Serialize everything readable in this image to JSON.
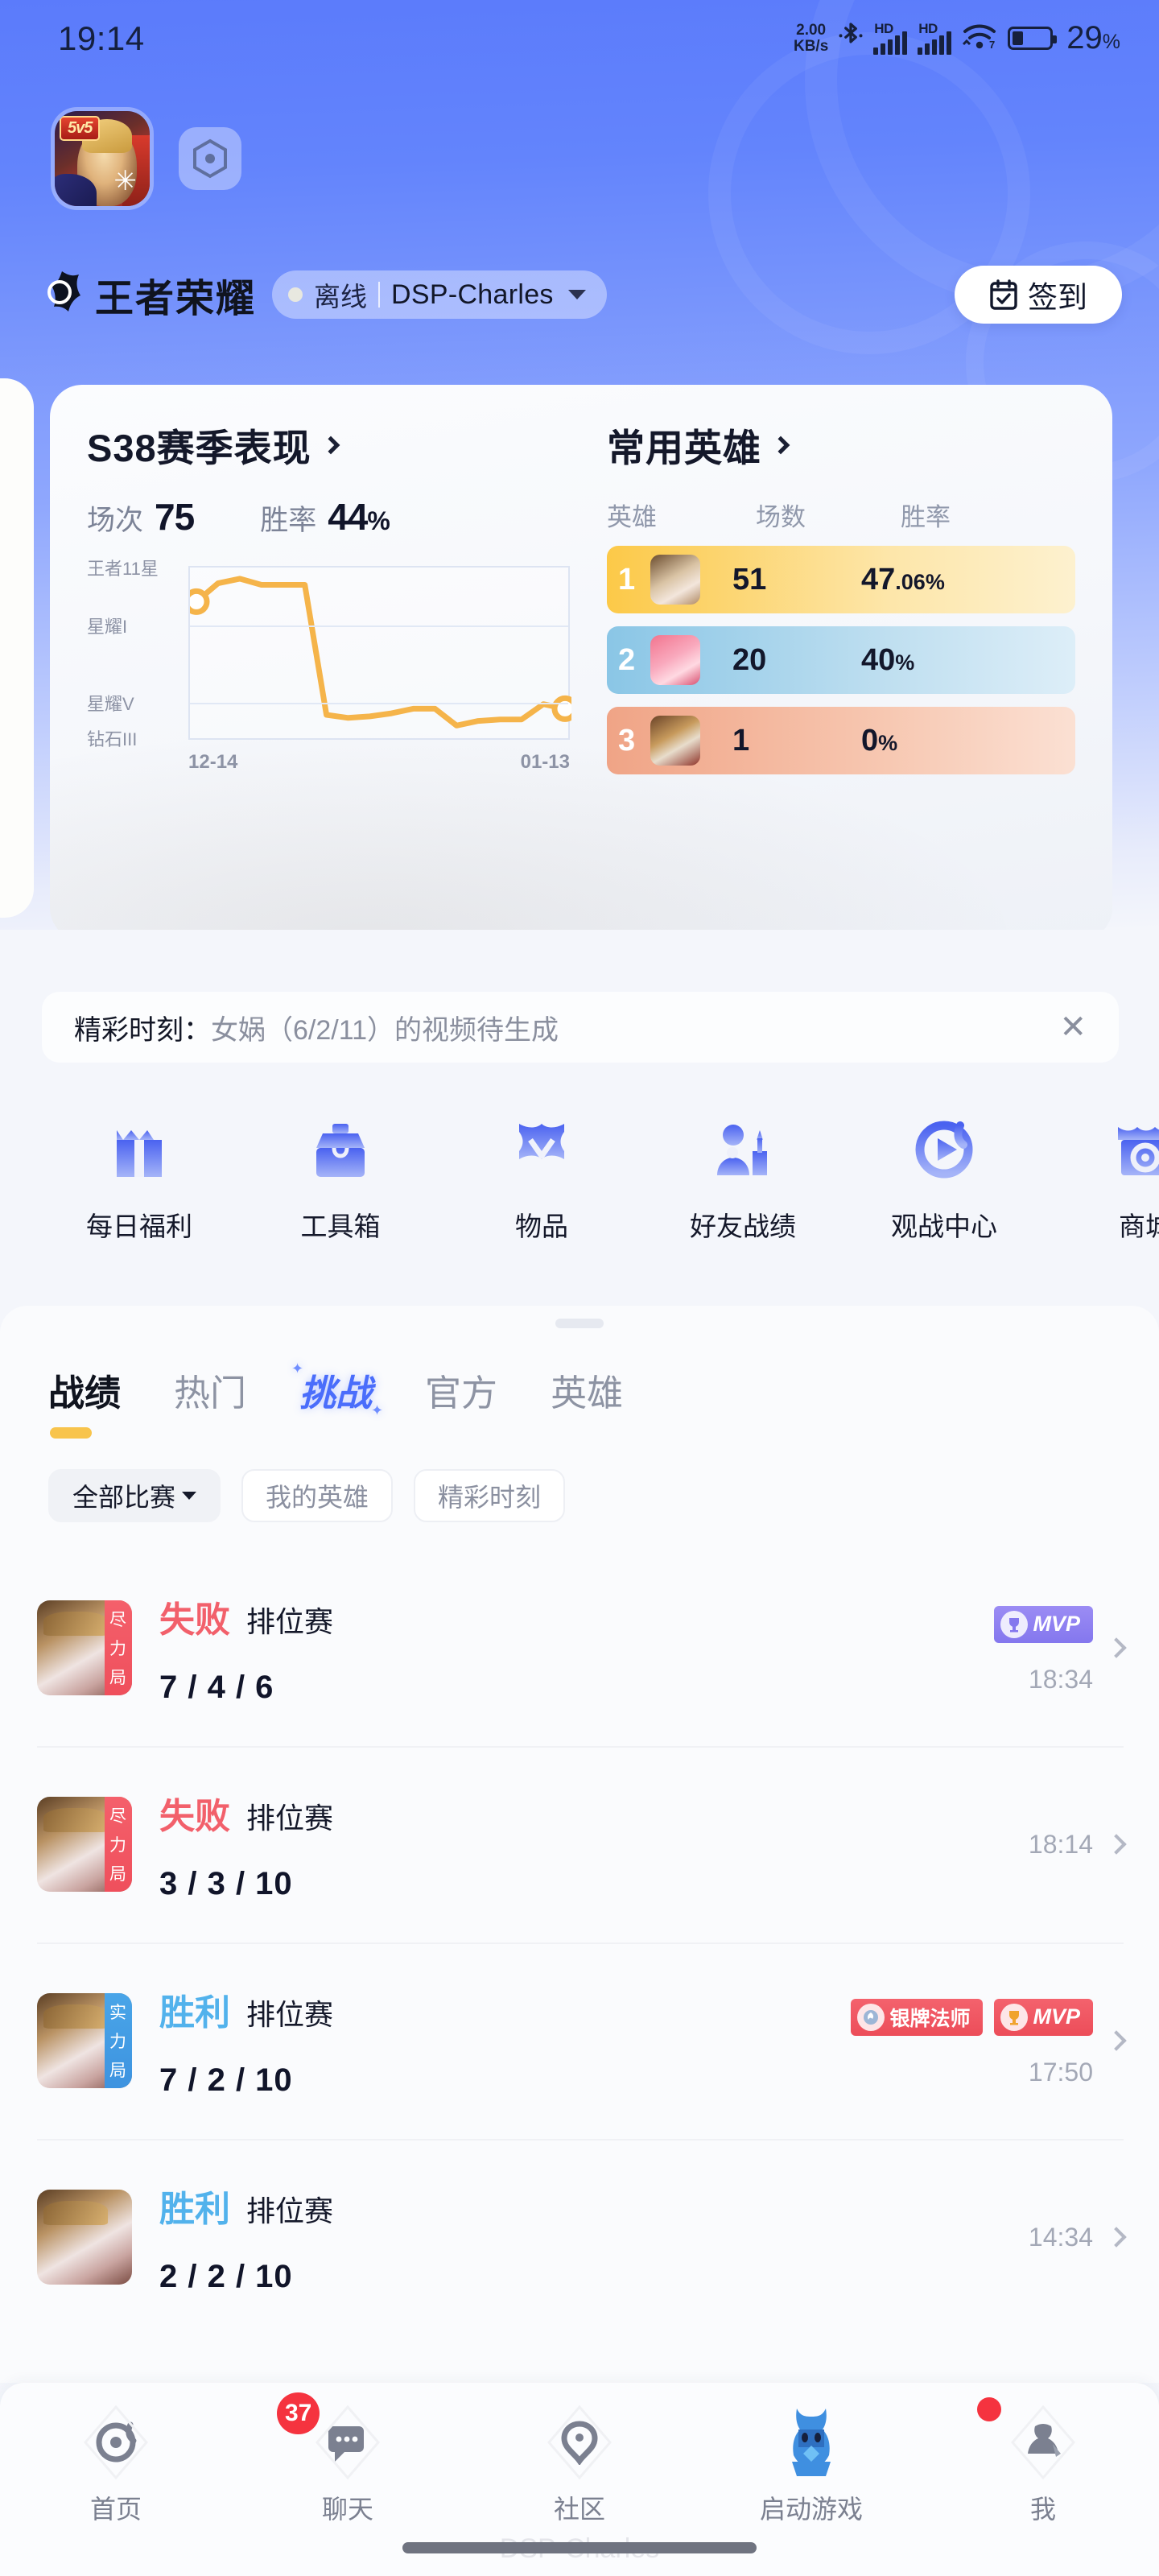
{
  "status_bar": {
    "time": "19:14",
    "net_speed_value": "2.00",
    "net_speed_unit": "KB/s",
    "bluetooth_icon": "bluetooth-icon",
    "sim1_label": "HD",
    "sim2_label": "HD",
    "wifi_label": "7",
    "battery_percent": "29",
    "battery_percent_symbol": "%",
    "battery_level": 29
  },
  "header": {
    "app_icon_badge": "5v5",
    "hex_button_icon": "hexagon-icon",
    "logo_text": "王者荣耀",
    "account": {
      "status": "离线",
      "name": "DSP-Charles",
      "dropdown_icon": "chevron-down-icon"
    },
    "signin_button": {
      "label": "签到",
      "icon": "calendar-check-icon"
    }
  },
  "season_card": {
    "title": "S38赛季表现",
    "title_arrow": "chevron-right-icon",
    "matches_label": "场次",
    "matches_value": "75",
    "winrate_label": "胜率",
    "winrate_value": "44",
    "winrate_unit": "%"
  },
  "chart_data": {
    "type": "line",
    "title": "S38赛季表现",
    "xlabel": "",
    "ylabel": "",
    "grid": true,
    "legend": "none",
    "line_color": "#f5b44a",
    "ytick_labels": [
      "王者11星",
      "星耀I",
      "星耀V",
      "钻石III"
    ],
    "ytick_values": [
      100,
      66,
      22,
      0
    ],
    "xtick_labels": [
      "12-14",
      "01-13"
    ],
    "x": [
      0,
      1,
      2,
      3,
      4,
      5,
      6,
      7,
      8,
      9,
      10,
      11,
      12,
      13,
      14,
      15,
      16,
      17
    ],
    "y": [
      84,
      96,
      99,
      95,
      95,
      95,
      10,
      8,
      9,
      11,
      14,
      14,
      3,
      6,
      7,
      7,
      17,
      14
    ],
    "ylim": [
      0,
      100
    ],
    "markers": [
      {
        "x": 0,
        "y": 84,
        "label": "start"
      },
      {
        "x": 17,
        "y": 14,
        "label": "end"
      }
    ]
  },
  "hero_card": {
    "title": "常用英雄",
    "title_arrow": "chevron-right-icon",
    "columns": [
      "英雄",
      "场数",
      "胜率"
    ],
    "rows": [
      {
        "rank": "1",
        "avatar": "hero-avatar-1",
        "games": "51",
        "winrate_int": "47",
        "winrate_dec": ".06",
        "winrate_unit": "%"
      },
      {
        "rank": "2",
        "avatar": "hero-avatar-2",
        "games": "20",
        "winrate_int": "40",
        "winrate_dec": "",
        "winrate_unit": "%"
      },
      {
        "rank": "3",
        "avatar": "hero-avatar-3",
        "games": "1",
        "winrate_int": "0",
        "winrate_dec": "",
        "winrate_unit": "%"
      }
    ]
  },
  "highlight_banner": {
    "prefix": "精彩时刻：",
    "text": "女娲（6/2/11）的视频待生成",
    "close_icon": "close-icon"
  },
  "quick_actions": [
    {
      "label": "每日福利",
      "icon": "gift-icon"
    },
    {
      "label": "工具箱",
      "icon": "toolbox-icon"
    },
    {
      "label": "物品",
      "icon": "item-icon"
    },
    {
      "label": "好友战绩",
      "icon": "friend-record-icon"
    },
    {
      "label": "观战中心",
      "icon": "spectate-icon"
    },
    {
      "label": "商城",
      "icon": "shop-icon"
    }
  ],
  "panel": {
    "tabs": [
      {
        "label": "战绩",
        "active": true
      },
      {
        "label": "热门",
        "active": false
      },
      {
        "label": "挑战",
        "active": false,
        "special": true
      },
      {
        "label": "官方",
        "active": false
      },
      {
        "label": "英雄",
        "active": false
      }
    ],
    "chips": [
      {
        "label": "全部比赛",
        "selected": true,
        "has_caret": true
      },
      {
        "label": "我的英雄",
        "selected": false,
        "has_caret": false
      },
      {
        "label": "精彩时刻",
        "selected": false,
        "has_caret": false
      }
    ]
  },
  "matches": [
    {
      "tag": "尽力局",
      "tag_color": "red",
      "result": "失败",
      "result_type": "lose",
      "mode": "排位赛",
      "kda": "7 / 4 / 6",
      "badges": [
        {
          "text": "MVP",
          "style": "mvp-purple",
          "icon": "trophy-icon"
        }
      ],
      "time": "18:34",
      "layout": "stacked",
      "chevron": "chevron-right-icon"
    },
    {
      "tag": "尽力局",
      "tag_color": "red",
      "result": "失败",
      "result_type": "lose",
      "mode": "排位赛",
      "kda": "3 / 3 / 10",
      "badges": [],
      "time": "18:14",
      "layout": "inline",
      "chevron": "chevron-right-icon"
    },
    {
      "tag": "实力局",
      "tag_color": "blue",
      "result": "胜利",
      "result_type": "win",
      "mode": "排位赛",
      "kda": "7 / 2 / 10",
      "badges": [
        {
          "text": "银牌法师",
          "style": "silver",
          "icon": "medal-icon"
        },
        {
          "text": "MVP",
          "style": "mvp-red",
          "icon": "trophy-icon"
        }
      ],
      "time": "17:50",
      "layout": "stacked",
      "chevron": "chevron-right-icon"
    },
    {
      "tag": "",
      "tag_color": "none",
      "result": "胜利",
      "result_type": "win",
      "mode": "排位赛",
      "kda": "2 / 2 / 10",
      "badges": [],
      "time": "14:34",
      "layout": "inline",
      "chevron": "chevron-right-icon"
    }
  ],
  "bottom_nav": [
    {
      "label": "首页",
      "icon": "home-icon",
      "badge": "",
      "dot": false,
      "active": false
    },
    {
      "label": "聊天",
      "icon": "chat-icon",
      "badge": "37",
      "dot": false,
      "active": false
    },
    {
      "label": "社区",
      "icon": "community-icon",
      "badge": "",
      "dot": false,
      "active": false
    },
    {
      "label": "启动游戏",
      "icon": "launch-game-icon",
      "badge": "",
      "dot": false,
      "active": true
    },
    {
      "label": "我",
      "icon": "profile-icon",
      "badge": "",
      "dot": true,
      "active": false
    }
  ],
  "watermark": "DSP-Charles"
}
